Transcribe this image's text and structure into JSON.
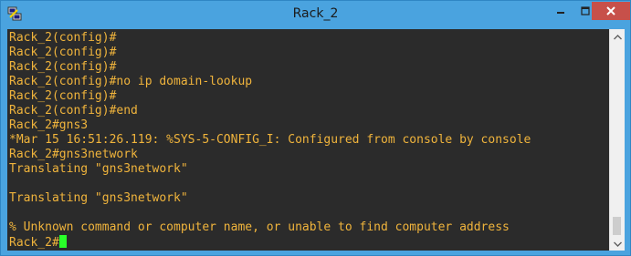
{
  "window": {
    "title": "Rack_2",
    "accent": "#4aa3df",
    "close_color": "#c7504a"
  },
  "icons": {
    "app": "putty-app-icon",
    "minimize": "minimize-icon",
    "maximize": "maximize-icon",
    "close": "close-icon",
    "scroll_up": "scroll-up-arrow-icon",
    "scroll_down": "scroll-down-arrow-icon"
  },
  "terminal": {
    "background": "#2b2b2b",
    "text_color": "#f0b43c",
    "cursor_color": "#29ff29",
    "lines": [
      "Rack_2(config)#",
      "Rack_2(config)#",
      "Rack_2(config)#",
      "Rack_2(config)#no ip domain-lookup",
      "Rack_2(config)#",
      "Rack_2(config)#end",
      "Rack_2#gns3",
      "*Mar 15 16:51:26.119: %SYS-5-CONFIG_I: Configured from console by console",
      "Rack_2#gns3network",
      "Translating \"gns3network\"",
      "",
      "Translating \"gns3network\"",
      "",
      "% Unknown command or computer name, or unable to find computer address"
    ],
    "prompt": "Rack_2#"
  }
}
